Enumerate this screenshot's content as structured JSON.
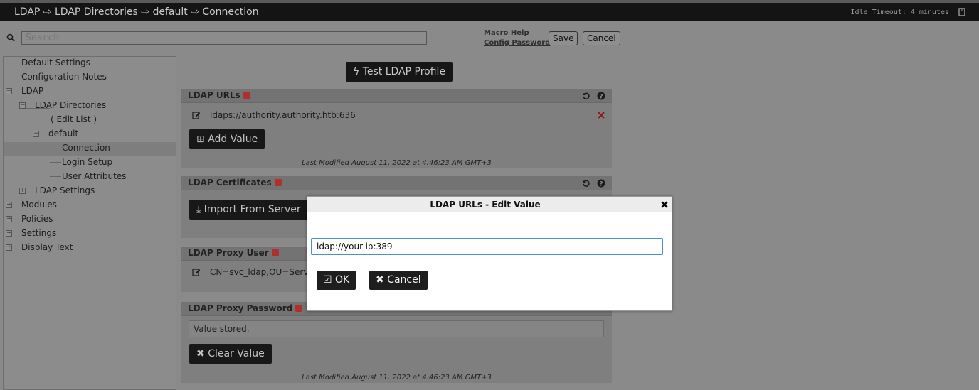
{
  "header": {
    "breadcrumb": "LDAP ⇨ LDAP Directories ⇨ default ⇨ Connection",
    "idle_timeout": "Idle Timeout: 4 minutes",
    "icon": "book-icon"
  },
  "toolbar": {
    "search_placeholder": "Search",
    "macro_help": "Macro Help",
    "config_password": "Config Password",
    "save_label": "Save",
    "cancel_label": "Cancel"
  },
  "sidebar": {
    "items": [
      {
        "label": "Default Settings"
      },
      {
        "label": "Configuration Notes"
      },
      {
        "label": "LDAP"
      },
      {
        "label": "LDAP Directories"
      },
      {
        "label": "(  Edit List  )"
      },
      {
        "label": "default"
      },
      {
        "label": "Connection",
        "selected": true
      },
      {
        "label": "Login Setup"
      },
      {
        "label": "User Attributes"
      },
      {
        "label": "LDAP Settings"
      },
      {
        "label": "Modules"
      },
      {
        "label": "Policies"
      },
      {
        "label": "Settings"
      },
      {
        "label": "Display Text"
      }
    ]
  },
  "main": {
    "test_button": "Test LDAP Profile",
    "panels": {
      "urls": {
        "title": "LDAP URLs",
        "value": "ldaps://authority.authority.htb:636",
        "add_label": "Add Value",
        "modified": "Last Modified August 11, 2022 at 4:46:23 AM GMT+3"
      },
      "certificates": {
        "title": "LDAP Certificates",
        "import_label": "Import From Server"
      },
      "proxy_user": {
        "title": "LDAP Proxy User",
        "value": "CN=svc_ldap,OU=Service"
      },
      "proxy_password": {
        "title": "LDAP Proxy Password",
        "stored": "Value stored.",
        "clear_label": "Clear Value",
        "modified": "Last Modified August 11, 2022 at 4:46:23 AM GMT+3"
      }
    }
  },
  "dialog": {
    "title": "LDAP URLs - Edit Value",
    "input_value": "ldap://your-ip:389",
    "ok_label": "OK",
    "cancel_label": "Cancel"
  },
  "colors": {
    "topbar": "#141414",
    "overlay_gray": "#8a8a8a",
    "focus_blue": "#4a90d9",
    "edit_badge_red": "#b03030",
    "delete_red": "#8b1a1a"
  }
}
